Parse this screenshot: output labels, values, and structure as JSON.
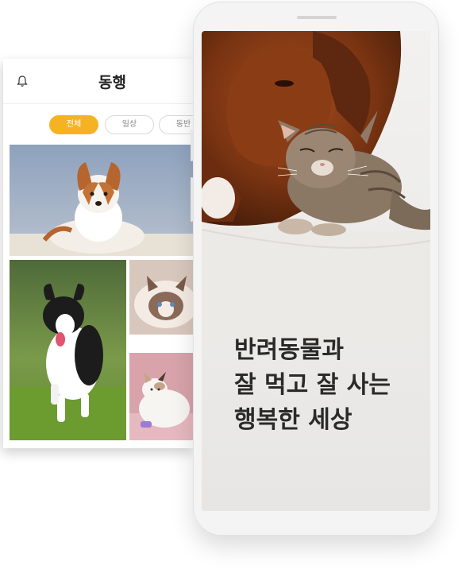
{
  "back_screen": {
    "title": "동행",
    "chips": [
      "전체",
      "일상",
      "동반"
    ]
  },
  "front_screen": {
    "headline_lines": [
      "반려동물과",
      "잘 먹고 잘 사는",
      "행복한 세상"
    ]
  }
}
